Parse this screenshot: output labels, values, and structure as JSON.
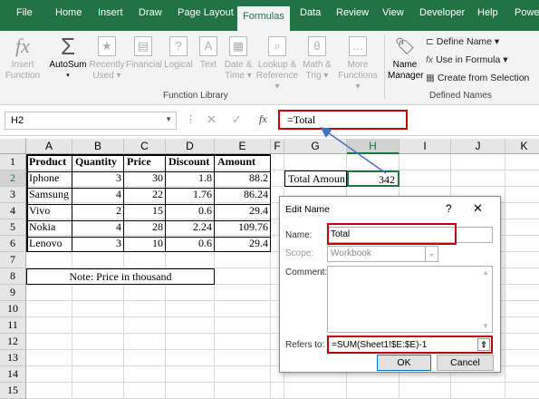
{
  "tabs": [
    "File",
    "Home",
    "Insert",
    "Draw",
    "Page Layout",
    "Formulas",
    "Data",
    "Review",
    "View",
    "Developer",
    "Help",
    "Powe"
  ],
  "ribbon": {
    "insert_function": [
      "Insert",
      "Function"
    ],
    "autosum": "AutoSum",
    "recently_used": [
      "Recently",
      "Used"
    ],
    "financial": "Financial",
    "logical": "Logical",
    "text": "Text",
    "date_time": [
      "Date &",
      "Time"
    ],
    "lookup_reference": [
      "Lookup &",
      "Reference"
    ],
    "math_trig": [
      "Math &",
      "Trig"
    ],
    "more_functions": [
      "More",
      "Functions"
    ],
    "function_library_label": "Function Library",
    "name_manager": [
      "Name",
      "Manager"
    ],
    "define_name": "Define Name",
    "use_in_formula": "Use in Formula",
    "create_from_selection": "Create from Selection",
    "defined_names_label": "Defined Names"
  },
  "formula_bar": {
    "name_box": "H2",
    "fx": "fx",
    "formula": "=Total"
  },
  "columns": [
    "A",
    "B",
    "C",
    "D",
    "E",
    "F",
    "G",
    "H",
    "I",
    "J",
    "K"
  ],
  "rows": [
    "1",
    "2",
    "3",
    "4",
    "5",
    "6",
    "7",
    "8",
    "9",
    "10",
    "11",
    "12",
    "13",
    "14",
    "15"
  ],
  "table": {
    "headers": [
      "Product",
      "Quantity",
      "Price",
      "Discount",
      "Amount"
    ],
    "data": [
      [
        "Iphone",
        "3",
        "30",
        "1.8",
        "88.2"
      ],
      [
        "Samsung",
        "4",
        "22",
        "1.76",
        "86.24"
      ],
      [
        "Vivo",
        "2",
        "15",
        "0.6",
        "29.4"
      ],
      [
        "Nokia",
        "4",
        "28",
        "2.24",
        "109.76"
      ],
      [
        "Lenovo",
        "3",
        "10",
        "0.6",
        "29.4"
      ]
    ]
  },
  "note": "Note: Price in thousand",
  "total_label": "Total Amoun",
  "total_value": "342",
  "dialog": {
    "title": "Edit Name",
    "help": "?",
    "close": "✕",
    "name_label": "Name:",
    "name_value": "Total",
    "scope_label": "Scope:",
    "scope_value": "Workbook",
    "comment_label": "Comment:",
    "refers_label": "Refers to:",
    "refers_value": "=SUM(Sheet1!$E:$E)-1",
    "ok": "OK",
    "cancel": "Cancel"
  },
  "colors": {
    "excel_green": "#217346",
    "highlight_red": "#c00000",
    "arrow_blue": "#4472c4",
    "selected_cell": "#217346"
  }
}
